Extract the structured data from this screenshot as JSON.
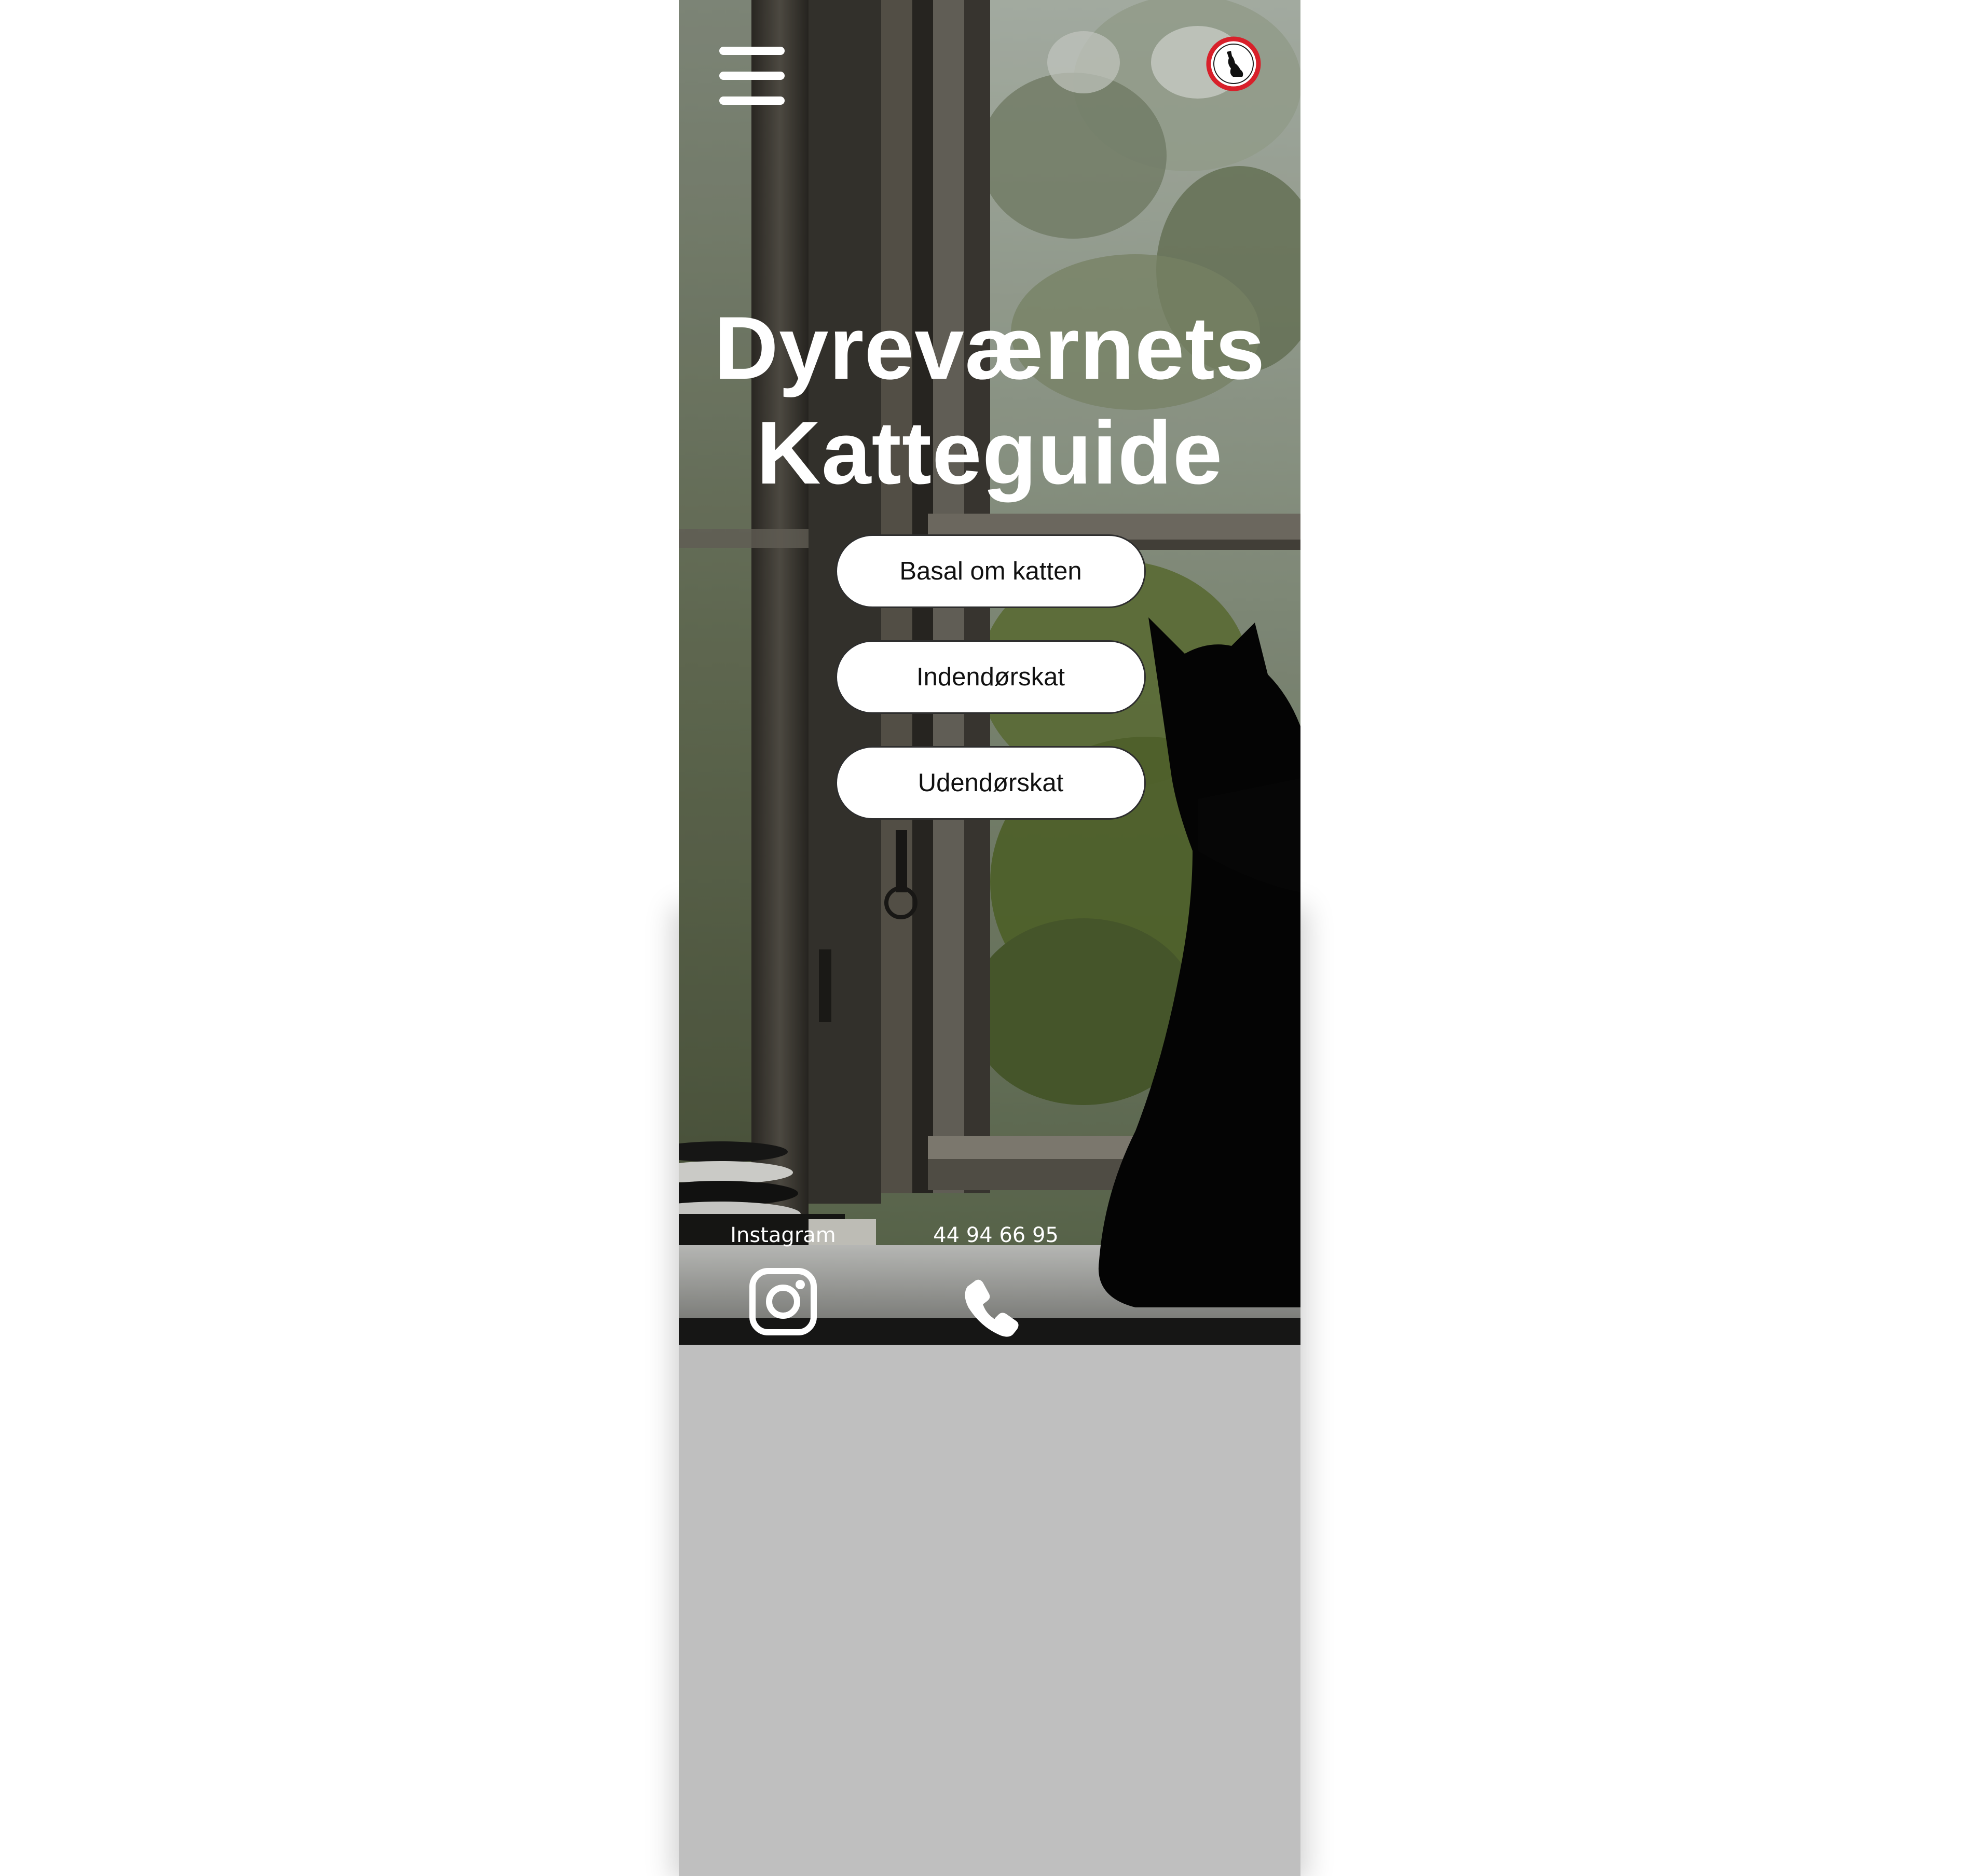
{
  "header": {
    "menu_icon": "hamburger-menu-icon",
    "logo_icon": "dyrevaernet-cat-logo-icon",
    "logo_colors": {
      "ring": "#d8202a",
      "fill": "#ffffff",
      "figure": "#111111"
    }
  },
  "hero": {
    "title_line1": "Dyreværnets",
    "title_line2": "Katteguide"
  },
  "nav_buttons": [
    {
      "label": "Basal om katten"
    },
    {
      "label": "Indendørskat"
    },
    {
      "label": "Udendørskat"
    }
  ],
  "footer": {
    "instagram_label": "Instagram",
    "instagram_icon": "instagram-icon",
    "phone_label": "44 94 66 95",
    "phone_icon": "phone-icon"
  },
  "colors": {
    "text": "#ffffff",
    "button_bg": "#ffffff",
    "button_text": "#111111",
    "below_screen": "#bfbfbf"
  }
}
